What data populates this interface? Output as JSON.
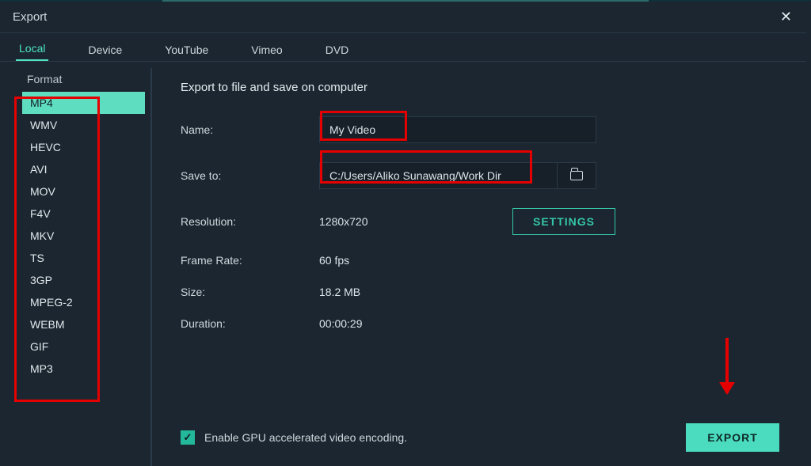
{
  "window": {
    "title": "Export"
  },
  "tabs": [
    "Local",
    "Device",
    "YouTube",
    "Vimeo",
    "DVD"
  ],
  "active_tab_index": 0,
  "sidebar": {
    "title": "Format",
    "items": [
      "MP4",
      "WMV",
      "HEVC",
      "AVI",
      "MOV",
      "F4V",
      "MKV",
      "TS",
      "3GP",
      "MPEG-2",
      "WEBM",
      "GIF",
      "MP3"
    ],
    "selected_index": 0
  },
  "main": {
    "title": "Export to file and save on computer",
    "labels": {
      "name": "Name:",
      "save_to": "Save to:",
      "resolution": "Resolution:",
      "frame_rate": "Frame Rate:",
      "size": "Size:",
      "duration": "Duration:"
    },
    "values": {
      "name": "My Video",
      "save_to": "C:/Users/Aliko Sunawang/Work Dir",
      "resolution": "1280x720",
      "frame_rate": "60 fps",
      "size": "18.2 MB",
      "duration": "00:00:29"
    },
    "buttons": {
      "settings": "SETTINGS",
      "export": "EXPORT"
    },
    "gpu_checkbox": {
      "checked": true,
      "label": "Enable GPU accelerated video encoding."
    }
  }
}
